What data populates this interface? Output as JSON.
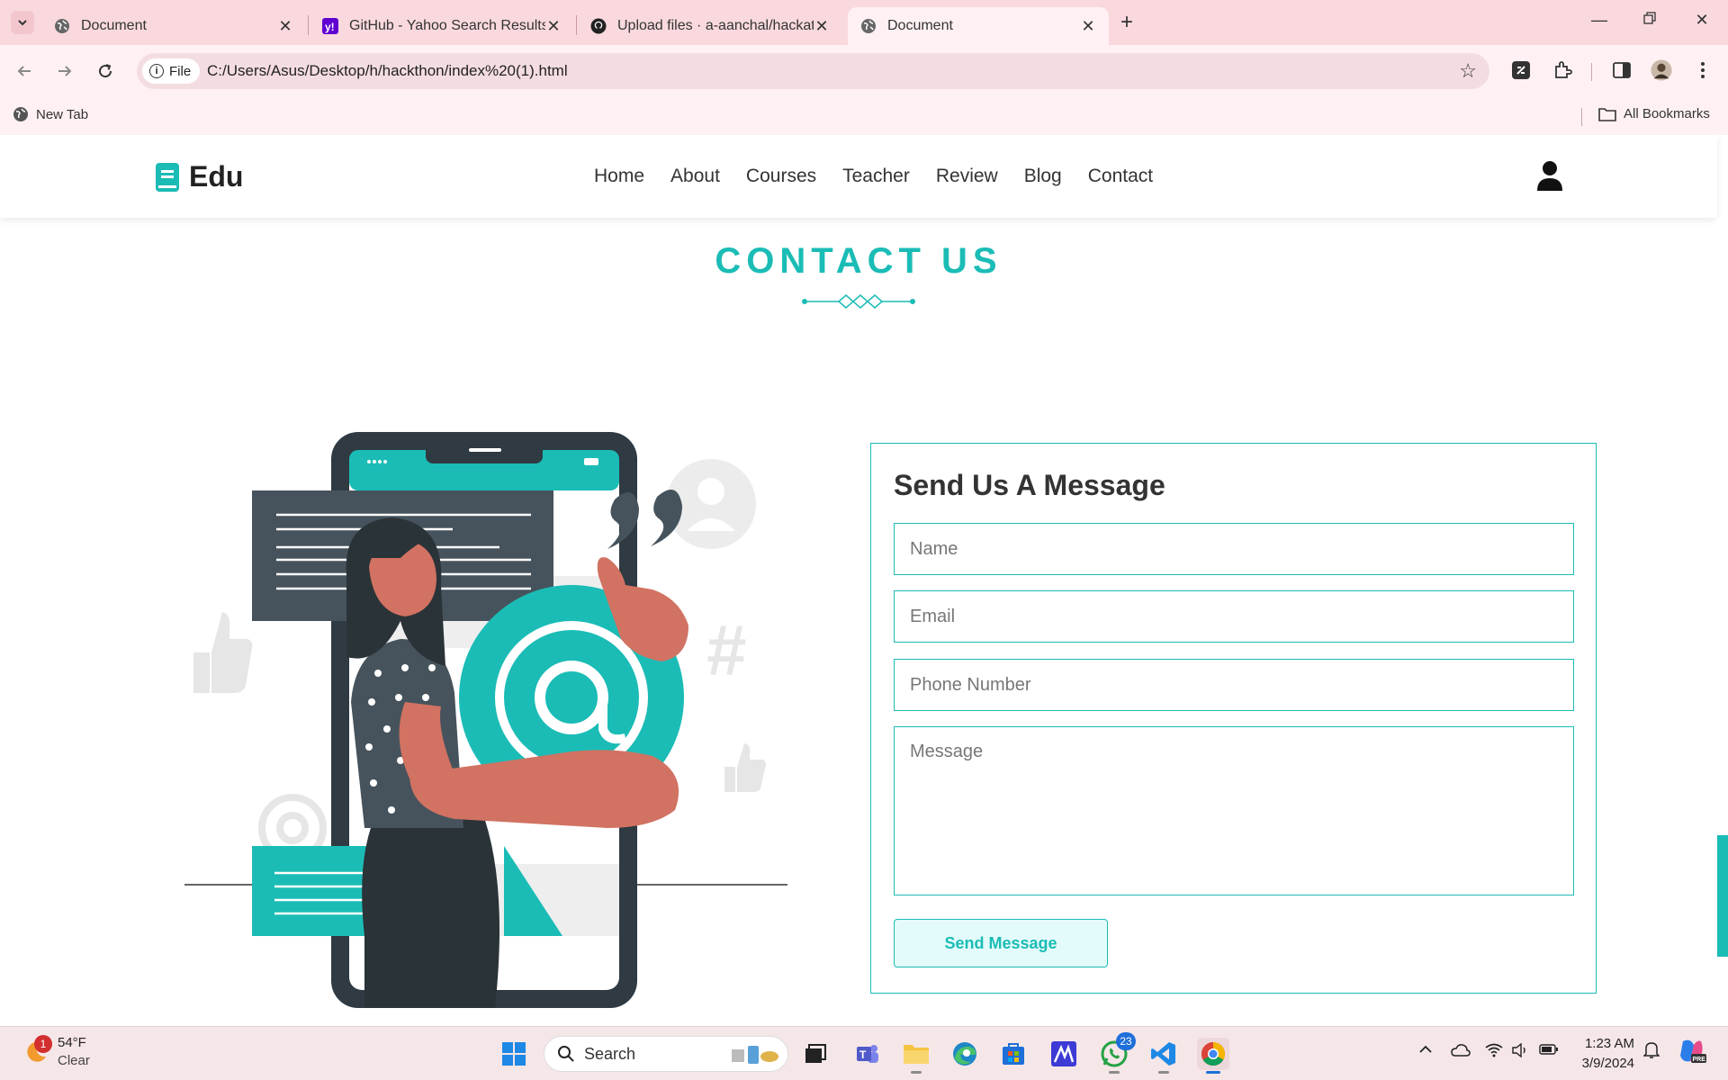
{
  "browser": {
    "tabs": [
      {
        "title": "Document",
        "active": false
      },
      {
        "title": "GitHub - Yahoo Search Results",
        "active": false
      },
      {
        "title": "Upload files · a-aanchal/hackathon",
        "active": false
      },
      {
        "title": "Document",
        "active": true
      }
    ],
    "close_glyph": "✕",
    "new_tab_glyph": "+",
    "address_chip": "File",
    "url": "C:/Users/Asus/Desktop/h/hackthon/index%20(1).html",
    "bookmarks": {
      "left_item": "New Tab",
      "right_item": "All Bookmarks"
    }
  },
  "site": {
    "brand": "Edu",
    "brand_color": "#1bbcb6",
    "nav": [
      "Home",
      "About",
      "Courses",
      "Teacher",
      "Review",
      "Blog",
      "Contact"
    ],
    "section_title": "CONTACT US"
  },
  "contact_form": {
    "title": "Send Us A Message",
    "name_placeholder": "Name",
    "email_placeholder": "Email",
    "phone_placeholder": "Phone Number",
    "message_placeholder": "Message",
    "submit_label": "Send Message"
  },
  "taskbar": {
    "weather_temp": "54°F",
    "weather_desc": "Clear",
    "weather_badge": "1",
    "search_label": "Search",
    "whatsapp_badge": "23",
    "time": "1:23 AM",
    "date": "3/9/2024"
  }
}
